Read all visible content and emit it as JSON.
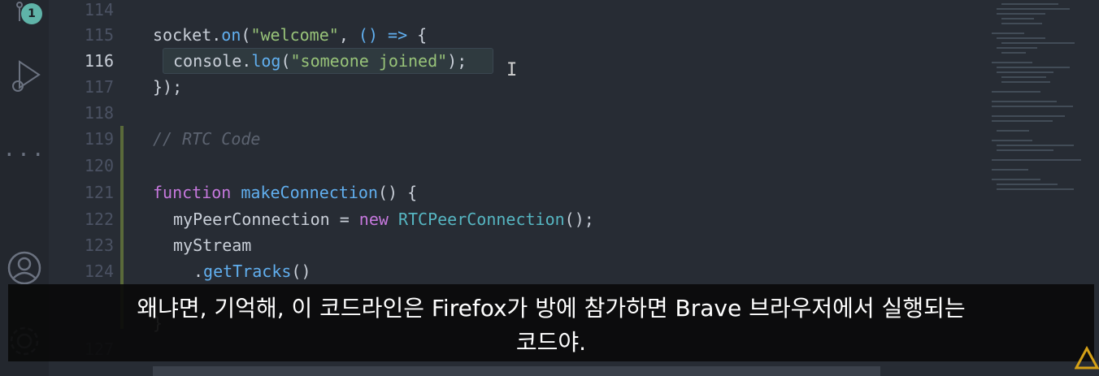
{
  "activity_bar": {
    "badge_count": "1",
    "icons": [
      "source-control-icon",
      "run-debug-icon",
      "more-icon",
      "account-icon",
      "settings-icon"
    ]
  },
  "editor": {
    "lines": [
      {
        "num": "114",
        "text": ""
      },
      {
        "num": "115",
        "text": "socket.on(\"welcome\", () => {"
      },
      {
        "num": "116",
        "text": "console.log(\"someone joined\");"
      },
      {
        "num": "117",
        "text": "});"
      },
      {
        "num": "118",
        "text": ""
      },
      {
        "num": "119",
        "text": "// RTC Code"
      },
      {
        "num": "120",
        "text": ""
      },
      {
        "num": "121",
        "text": "function makeConnection() {"
      },
      {
        "num": "122",
        "text": "myPeerConnection = new RTCPeerConnection();"
      },
      {
        "num": "123",
        "text": "myStream"
      },
      {
        "num": "124",
        "text": ".getTracks()"
      },
      {
        "num": "127",
        "text": "}"
      }
    ],
    "active_line": "116"
  },
  "subtitle": {
    "line1": "왜냐면, 기억해, 이 코드라인은 Firefox가 방에 참가하면 Brave 브라우저에서 실행되는",
    "line2": "코드야."
  },
  "colors": {
    "background": "#272c34",
    "keyword": "#c678dd",
    "function": "#61afef",
    "string": "#98c379",
    "comment": "#5c6370"
  }
}
